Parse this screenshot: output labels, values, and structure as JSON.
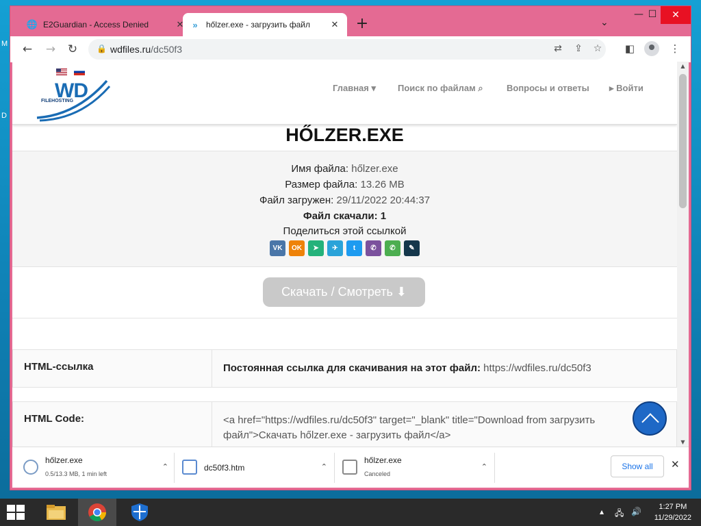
{
  "desktop": {
    "left_letters": [
      "M",
      "D"
    ]
  },
  "browser": {
    "tabs": [
      {
        "title": "E2Guardian - Access Denied",
        "active": false
      },
      {
        "title": "hőlzer.exe - загрузить файл",
        "active": true
      }
    ],
    "url_host": "wdfiles.ru",
    "url_path": "/dc50f3"
  },
  "site": {
    "logo_text": "WD",
    "logo_sub": "FILEHOSTING",
    "nav": [
      {
        "label": "Главная ▾"
      },
      {
        "label": "Поиск по файлам ⌕"
      },
      {
        "label": "Вопросы и ответы"
      },
      {
        "label": "▸ Войти"
      }
    ]
  },
  "file": {
    "title": "HŐLZER.EXE",
    "name_label": "Имя файла:",
    "name_value": "hőlzer.exe",
    "size_label": "Размер файла:",
    "size_value": "13.26 MB",
    "uploaded_label": "Файл загружен:",
    "uploaded_value": "29/11/2022 20:44:37",
    "downloads_label": "Файл скачали:",
    "downloads_value": "1",
    "share_label": "Поделиться этой ссылкой",
    "share_buttons": [
      {
        "name": "vk",
        "glyph": "VK",
        "color": "#4a76a8"
      },
      {
        "name": "ok",
        "glyph": "OK",
        "color": "#ee8208"
      },
      {
        "name": "moimir",
        "glyph": "➤",
        "color": "#24b27b"
      },
      {
        "name": "telegram",
        "glyph": "✈",
        "color": "#2aa3d9"
      },
      {
        "name": "twitter",
        "glyph": "t",
        "color": "#1d9bf0"
      },
      {
        "name": "viber",
        "glyph": "✆",
        "color": "#7b519d"
      },
      {
        "name": "whatsapp",
        "glyph": "✆",
        "color": "#4cae50"
      },
      {
        "name": "livejournal",
        "glyph": "✎",
        "color": "#15374c"
      }
    ],
    "download_button": "Скачать / Смотреть ⬇"
  },
  "links_table": [
    {
      "label": "HTML-ссылка",
      "value_bold": "Постоянная ссылка для скачивания на этот файл:",
      "value": " https://wdfiles.ru/dc50f3"
    },
    {
      "label": "HTML Code:",
      "value_bold": "",
      "value": "<a href=\"https://wdfiles.ru/dc50f3\" target=\"_blank\" title=\"Download from загрузить файл\">Скачать hőlzer.exe - загрузить файл</a>"
    }
  ],
  "downloads_shelf": {
    "items": [
      {
        "name": "hőlzer.exe",
        "status": "0.5/13.3 MB, 1 min left"
      },
      {
        "name": "dc50f3.htm",
        "status": ""
      },
      {
        "name": "hőlzer.exe",
        "status": "Canceled"
      }
    ],
    "show_all": "Show all"
  },
  "taskbar": {
    "time": "1:27 PM",
    "date": "11/29/2022"
  }
}
